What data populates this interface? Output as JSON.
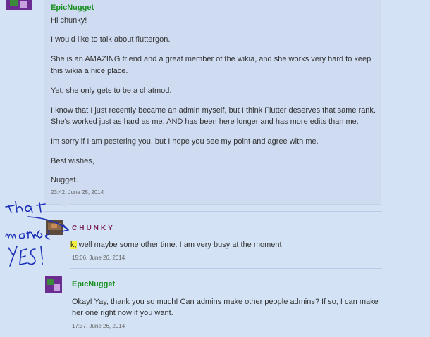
{
  "first_message": {
    "author": "EpicNugget",
    "lines": [
      "Hi chunky!",
      "I would like to talk about fluttergon.",
      "She is an AMAZING friend and a great member of the wikia, and she works very hard to keep",
      "this wikia a nice place.",
      "Yet, she only gets to be a chatmod.",
      "I know that I just recently became an admin myself, but I think Flutter deserves that same rank.",
      "She's worked just as hard as me, AND has been here longer and has more edits than me.",
      "Im sorry if I am pestering you, but I hope you see my point and agree with me.",
      "Best wishes,",
      "Nugget."
    ],
    "timestamp": "23:42, June 25, 2014"
  },
  "reply_one": {
    "author": "CHUNKY",
    "highlight": "k,",
    "text": " well maybe some other time. I am very busy at the moment",
    "timestamp": "15:06, June 26, 2014"
  },
  "reply_two": {
    "author": "EpicNugget",
    "lines": [
      "Okay! Yay, thank you so much! Can admins make other people admins? If so, I can make",
      "her one right now if you want."
    ],
    "timestamp": "17:37, June 26, 2014"
  },
  "annotation": {
    "color": "#1c2fb8"
  }
}
